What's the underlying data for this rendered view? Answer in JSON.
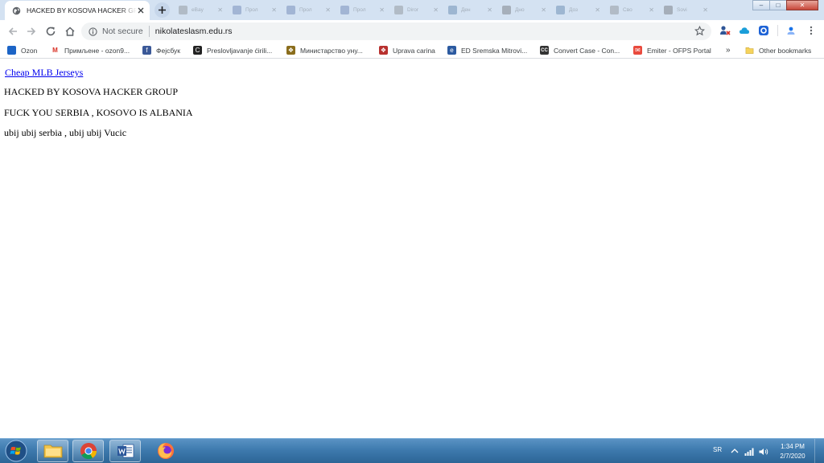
{
  "tabs": {
    "active_title": "HACKED BY KOSOVA HACKER GROUP",
    "new_tab_symbol": "+",
    "background_tabs": [
      {
        "label": "eBay",
        "icon": "page-icon",
        "color": "#6b6b6b"
      },
      {
        "label": "Прол",
        "icon": "facebook-icon",
        "color": "#3b5998"
      },
      {
        "label": "Прол",
        "icon": "facebook-icon",
        "color": "#3b5998"
      },
      {
        "label": "Прол",
        "icon": "facebook-icon",
        "color": "#3b5998"
      },
      {
        "label": "Diror",
        "icon": "page-icon",
        "color": "#6b6b6b"
      },
      {
        "label": "Ден",
        "icon": "user-icon",
        "color": "#2b5d8e"
      },
      {
        "label": "Дно",
        "icon": "globe-icon",
        "color": "#444444"
      },
      {
        "label": "Доз",
        "icon": "page-icon",
        "color": "#2b5d8e"
      },
      {
        "label": "Сво",
        "icon": "page-icon",
        "color": "#6b6b6b"
      },
      {
        "label": "Sovi",
        "icon": "globe-icon",
        "color": "#444444"
      }
    ]
  },
  "window_controls": {
    "minimize": "–",
    "maximize": "□",
    "close": "✕"
  },
  "address_bar": {
    "security_label": "Not secure",
    "url": "nikolateslasm.edu.rs"
  },
  "bookmarks": {
    "items": [
      {
        "label": "Ozon",
        "icon": "ozon-icon",
        "color": "#1c64c6"
      },
      {
        "label": "Примљене - ozon9...",
        "icon": "gmail-icon",
        "color": "#d93025"
      },
      {
        "label": "Фејсбук",
        "icon": "facebook-icon",
        "color": "#3b5998"
      },
      {
        "label": "Preslovljavanje ćirili...",
        "icon": "site-icon",
        "color": "#222222"
      },
      {
        "label": "Министарство уну...",
        "icon": "crest-icon",
        "color": "#8a6d1c"
      },
      {
        "label": "Uprava carina",
        "icon": "crest-icon",
        "color": "#b8312f"
      },
      {
        "label": "ED Sremska Mitrovi...",
        "icon": "ed-icon",
        "color": "#2c5aa0"
      },
      {
        "label": "Convert Case - Con...",
        "icon": "cc-icon",
        "color": "#333333"
      },
      {
        "label": "Emiter - OFPS Portal",
        "icon": "emiter-icon",
        "color": "#e94a3d"
      }
    ],
    "overflow": "»",
    "other_label": "Other bookmarks"
  },
  "page": {
    "link_text": "Cheap MLB Jerseys",
    "lines": [
      "HACKED BY KOSOVA HACKER GROUP",
      "FUCK YOU SERBIA , KOSOVO IS ALBANIA",
      "ubij ubij serbia , ubij ubij Vucic"
    ]
  },
  "taskbar": {
    "apps": [
      {
        "name": "explorer",
        "icon": "folder-icon"
      },
      {
        "name": "chrome",
        "icon": "chrome-icon"
      },
      {
        "name": "word",
        "icon": "word-icon"
      },
      {
        "name": "firefox",
        "icon": "firefox-icon"
      }
    ],
    "language": "SR",
    "time": "1:34 PM",
    "date": "2/7/2020"
  }
}
